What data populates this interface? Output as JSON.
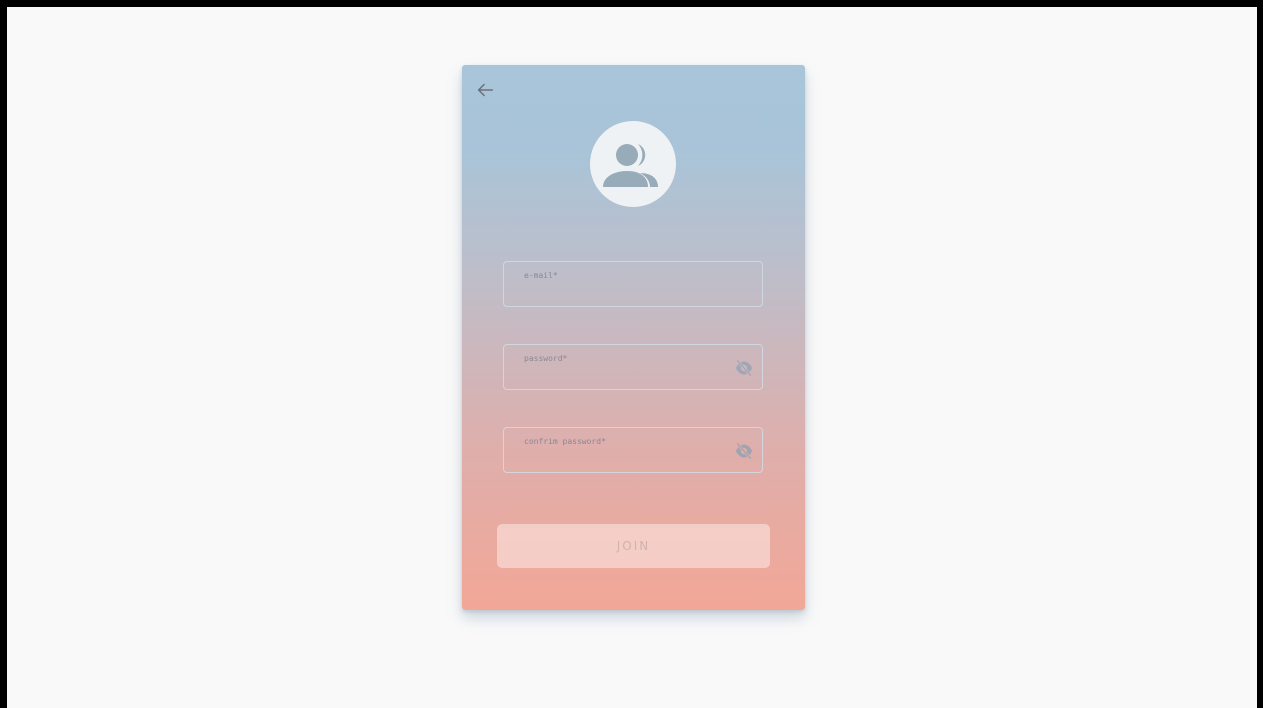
{
  "form": {
    "email": {
      "label": "e-mail",
      "required_mark": "*",
      "value": ""
    },
    "password": {
      "label": "password",
      "required_mark": "*",
      "value": ""
    },
    "confirm_password": {
      "label": "confrim password",
      "required_mark": "*",
      "value": ""
    },
    "submit_label": "JOIN"
  },
  "icons": {
    "back": "arrow-left-icon",
    "avatar": "users-icon",
    "password_toggle": "eye-off-icon"
  },
  "colors": {
    "background": "#f9f9f9",
    "gradient_top": "#a8c5d9",
    "gradient_bottom": "#f2a797",
    "button_fill": "#f6cdc5",
    "button_text": "#d0b3ad"
  }
}
